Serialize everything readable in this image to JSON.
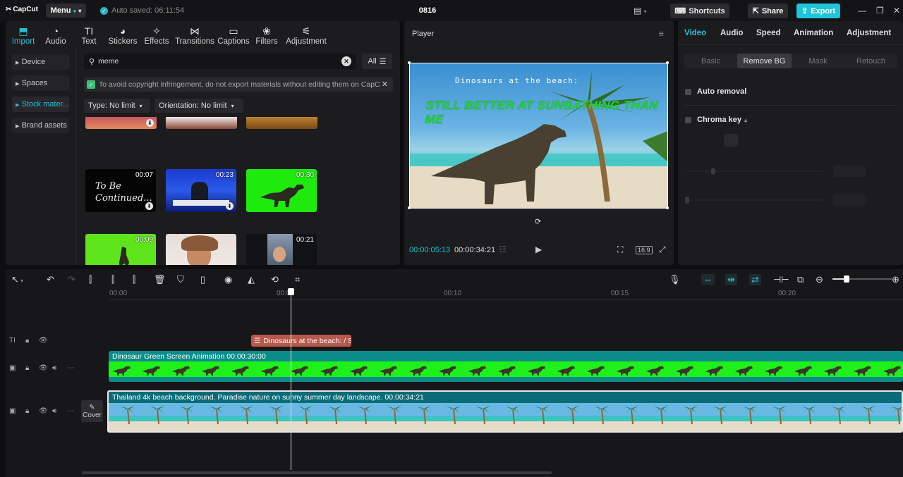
{
  "app": {
    "logo": "CapCut",
    "menu_label": "Menu",
    "autosave": "Auto saved: 06:11:54",
    "project_title": "0816",
    "shortcuts_label": "Shortcuts",
    "share_label": "Share",
    "export_label": "Export",
    "accent": "#1fc4d9"
  },
  "media": {
    "tabs": [
      {
        "label": "Import",
        "icon": "import-icon",
        "glyph": "⬒"
      },
      {
        "label": "Audio",
        "icon": "audio-icon",
        "glyph": "◔"
      },
      {
        "label": "Text",
        "icon": "text-icon",
        "glyph": "TI"
      },
      {
        "label": "Stickers",
        "icon": "sticker-icon",
        "glyph": "◕"
      },
      {
        "label": "Effects",
        "icon": "effects-icon",
        "glyph": "✧"
      },
      {
        "label": "Transitions",
        "icon": "transitions-icon",
        "glyph": "⋈"
      },
      {
        "label": "Captions",
        "icon": "captions-icon",
        "glyph": "▭"
      },
      {
        "label": "Filters",
        "icon": "filters-icon",
        "glyph": "❀"
      },
      {
        "label": "Adjustment",
        "icon": "adjustment-icon",
        "glyph": "⚟"
      }
    ],
    "side": [
      "Device",
      "Spaces",
      "Stock mater...",
      "Brand assets"
    ],
    "search_value": "meme",
    "all_label": "All",
    "notice": "To avoid copyright infringement, do not export materials without editing them on CapC",
    "filter_type": "Type: No limit",
    "filter_orientation": "Orientation: No limit",
    "thumbs": [
      {
        "dur": "",
        "download": true
      },
      {
        "dur": "",
        "download": false
      },
      {
        "dur": "",
        "download": false
      },
      {
        "dur": "00:07",
        "text": "To Be Continued...",
        "download": true
      },
      {
        "dur": "00:23",
        "download": true
      },
      {
        "dur": "00:30",
        "download": false
      },
      {
        "dur": "00:09",
        "download": false
      },
      {
        "dur": "",
        "download": true
      },
      {
        "dur": "00:21",
        "download": false
      }
    ]
  },
  "player": {
    "title": "Player",
    "caption_line1": "Dinosaurs at the beach:",
    "caption_line2": "STILL BETTER AT SUNBATHING THAN ME",
    "time_current": "00:00:05:13",
    "time_total": "00:00:34:21",
    "ratio_label": "16:9"
  },
  "props": {
    "tabs": [
      "Video",
      "Audio",
      "Speed",
      "Animation",
      "Adjustment"
    ],
    "subtabs": [
      "Basic",
      "Remove BG",
      "Mask",
      "Retouch"
    ],
    "active_subtab": "Remove BG",
    "auto_removal": "Auto removal",
    "chroma_key": "Chroma key"
  },
  "timeline": {
    "ruler": [
      "00:00",
      "00:05",
      "00:10",
      "00:15",
      "00:20"
    ],
    "text_clip": "Dinosaurs at the beach:  / St",
    "green_clip_label": "Dinosaur Green Screen Animation  00:00:30:00",
    "beach_clip_label": "Thailand 4k beach background. Paradise nature on sunny summer day landscape.  00:00:34:21",
    "cover_label": "Cover"
  }
}
